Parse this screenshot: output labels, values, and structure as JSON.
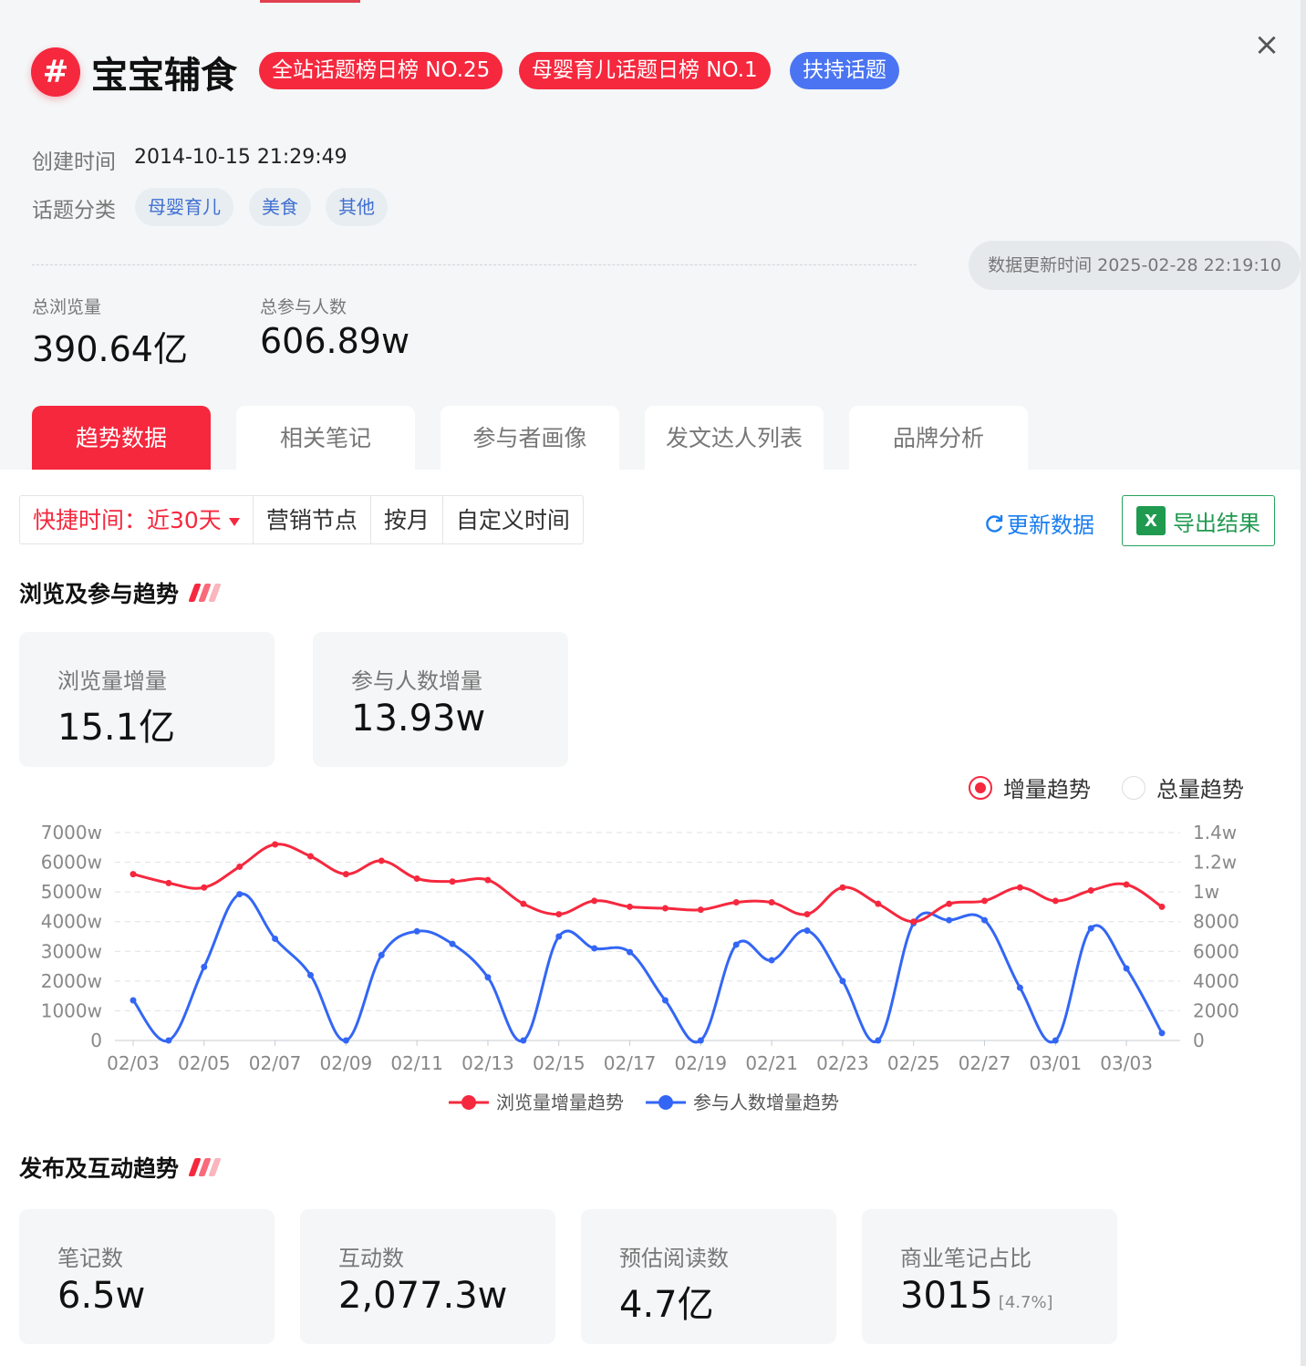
{
  "header": {
    "title": "宝宝辅食",
    "hash_symbol": "#",
    "tags": [
      {
        "label": "全站话题榜日榜 NO.25",
        "color": "#f5283e"
      },
      {
        "label": "母婴育儿话题日榜 NO.1",
        "color": "#f5283e"
      },
      {
        "label": "扶持话题",
        "color": "#4a74f2"
      }
    ],
    "close_icon": "×"
  },
  "meta": {
    "created_label": "创建时间",
    "created_value": "2014-10-15 21:29:49",
    "category_label": "话题分类",
    "categories": [
      "母婴育儿",
      "美食",
      "其他"
    ],
    "update_text": "数据更新时间 2025-02-28 22:19:10"
  },
  "totals": {
    "views_label": "总浏览量",
    "views_value": "390.64亿",
    "participants_label": "总参与人数",
    "participants_value": "606.89w"
  },
  "tabs": [
    {
      "label": "趋势数据",
      "active": true
    },
    {
      "label": "相关笔记",
      "active": false
    },
    {
      "label": "参与者画像",
      "active": false
    },
    {
      "label": "发文达人列表",
      "active": false
    },
    {
      "label": "品牌分析",
      "active": false
    }
  ],
  "filters": {
    "quick_label": "快捷时间：近30天",
    "items": [
      "营销节点",
      "按月",
      "自定义时间"
    ],
    "refresh_label": "更新数据",
    "export_label": "导出结果"
  },
  "section1": {
    "title": "浏览及参与趋势",
    "cards": [
      {
        "label": "浏览量增量",
        "value": "15.1亿"
      },
      {
        "label": "参与人数增量",
        "value": "13.93w"
      }
    ],
    "radio": [
      {
        "label": "增量趋势",
        "selected": true
      },
      {
        "label": "总量趋势",
        "selected": false
      }
    ]
  },
  "section2": {
    "title": "发布及互动趋势",
    "cards": [
      {
        "label": "笔记数",
        "value": "6.5w",
        "sub": ""
      },
      {
        "label": "互动数",
        "value": "2,077.3w",
        "sub": ""
      },
      {
        "label": "预估阅读数",
        "value": "4.7亿",
        "sub": ""
      },
      {
        "label": "商业笔记占比",
        "value": "3015",
        "sub": "[4.7%]"
      }
    ]
  },
  "chart_data": {
    "type": "line",
    "x": [
      "02/03",
      "02/04",
      "02/05",
      "02/06",
      "02/07",
      "02/08",
      "02/09",
      "02/10",
      "02/11",
      "02/12",
      "02/13",
      "02/14",
      "02/15",
      "02/16",
      "02/17",
      "02/18",
      "02/19",
      "02/20",
      "02/21",
      "02/22",
      "02/23",
      "02/24",
      "02/25",
      "02/26",
      "02/27",
      "02/28",
      "03/01",
      "03/02",
      "03/03",
      "03/04"
    ],
    "xticks": [
      "02/03",
      "02/05",
      "02/07",
      "02/09",
      "02/11",
      "02/13",
      "02/15",
      "02/17",
      "02/19",
      "02/21",
      "02/23",
      "02/25",
      "02/27",
      "03/01",
      "03/03"
    ],
    "y_left_ticks": [
      "0",
      "1000w",
      "2000w",
      "3000w",
      "4000w",
      "5000w",
      "6000w",
      "7000w"
    ],
    "y_right_ticks": [
      "0",
      "2000",
      "4000",
      "6000",
      "8000",
      "1w",
      "1.2w",
      "1.4w"
    ],
    "ylim_left": [
      0,
      7000
    ],
    "ylim_right": [
      0,
      14000
    ],
    "grid": true,
    "legend_position": "bottom",
    "series": [
      {
        "name": "浏览量增量趋势",
        "axis": "left",
        "unit": "w",
        "color": "#f5283e",
        "values": [
          5600,
          5300,
          5150,
          5850,
          6600,
          6200,
          5600,
          6050,
          5450,
          5350,
          5400,
          4600,
          4250,
          4700,
          4500,
          4450,
          4400,
          4650,
          4650,
          4250,
          5150,
          4600,
          4000,
          4600,
          4700,
          5150,
          4700,
          5050,
          5250,
          4500
        ]
      },
      {
        "name": "参与人数增量趋势",
        "axis": "right",
        "unit": "",
        "color": "#3366f5",
        "values": [
          2700,
          0,
          4950,
          9850,
          6850,
          4400,
          0,
          5750,
          7350,
          6500,
          4250,
          0,
          7000,
          6200,
          5950,
          2700,
          0,
          6450,
          5400,
          7400,
          4000,
          0,
          7900,
          8100,
          8100,
          3550,
          0,
          7550,
          4850,
          500
        ]
      }
    ]
  }
}
